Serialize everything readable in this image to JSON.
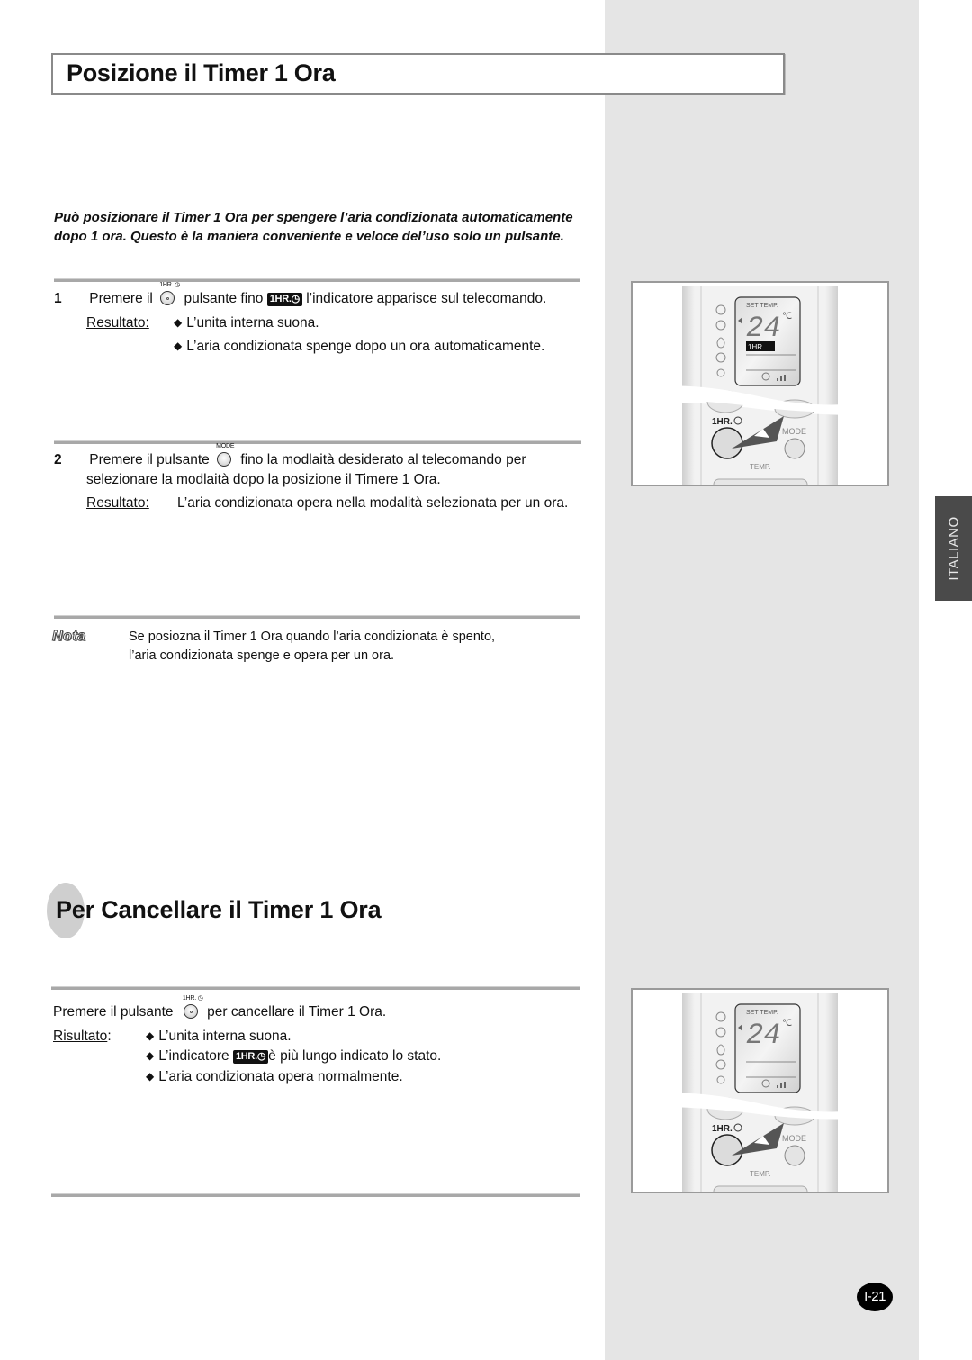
{
  "section1": {
    "title": "Posizione il Timer 1 Ora",
    "intro": "Può posizionare il Timer 1 Ora per spengere l’aria condizionata automaticamente dopo 1 ora. Questo è la maniera conveniente e veloce del’uso solo un pulsante.",
    "steps": [
      {
        "number": "1",
        "text_before": "Premere il",
        "button_icon": "1hr-timer-button-icon",
        "button_label": "1HR. ⏱",
        "text_mid": "pulsante fino",
        "indicator": "1HR.◷",
        "text_after": "l’indicatore apparisce sul telecomando.",
        "result_label": "Resultato:",
        "results": [
          "L’unita interna suona.",
          "L’aria condizionata spenge dopo un ora automaticamente."
        ]
      },
      {
        "number": "2",
        "text_before": "Premere il pulsante",
        "button_icon": "mode-button-icon",
        "button_label": "MODE",
        "text_after": "fino la modlaità desiderato al telecomando per",
        "text_line2": "selezionare la modlaità dopo la posizione il Timere 1 Ora.",
        "result_label": "Resultato:",
        "results": [
          "L’aria condizionata opera nella modalità selezionata per un ora."
        ]
      }
    ],
    "note": {
      "label": "Nota",
      "line1": "Se posiozna il Timer 1 Ora quando l’aria condizionata è spento,",
      "line2": "l’aria condizionata spenge e opera per un ora."
    }
  },
  "section2": {
    "title": "Per Cancellare il Timer 1 Ora",
    "text_before": "Premere il pulsante",
    "button_label": "1HR. ⏱",
    "text_after": "per cancellare il Timer 1 Ora.",
    "result_label": "Risultato",
    "result_colon": ":",
    "results": [
      {
        "text": "L’unita interna suona."
      },
      {
        "before": "L’indicatore",
        "indicator": "1HR.◷",
        "after": "è più lungo indicato lo stato."
      },
      {
        "text": "L’aria condizionata opera normalmente."
      }
    ]
  },
  "remote_illustration": {
    "lcd_label": "SET TEMP.",
    "temperature": "24",
    "unit": "℃",
    "indicator": "1HR.",
    "button_1hr": "1HR.",
    "button_mode": "MODE",
    "button_temp": "TEMP.",
    "mode_icons": [
      "auto-icon",
      "cool-icon",
      "dry-icon",
      "fan-icon",
      "heat-icon"
    ]
  },
  "sidebar": {
    "language_tab": "ITALIANO"
  },
  "footer": {
    "page_number": "I-21"
  },
  "bullet_glyph": "◆"
}
